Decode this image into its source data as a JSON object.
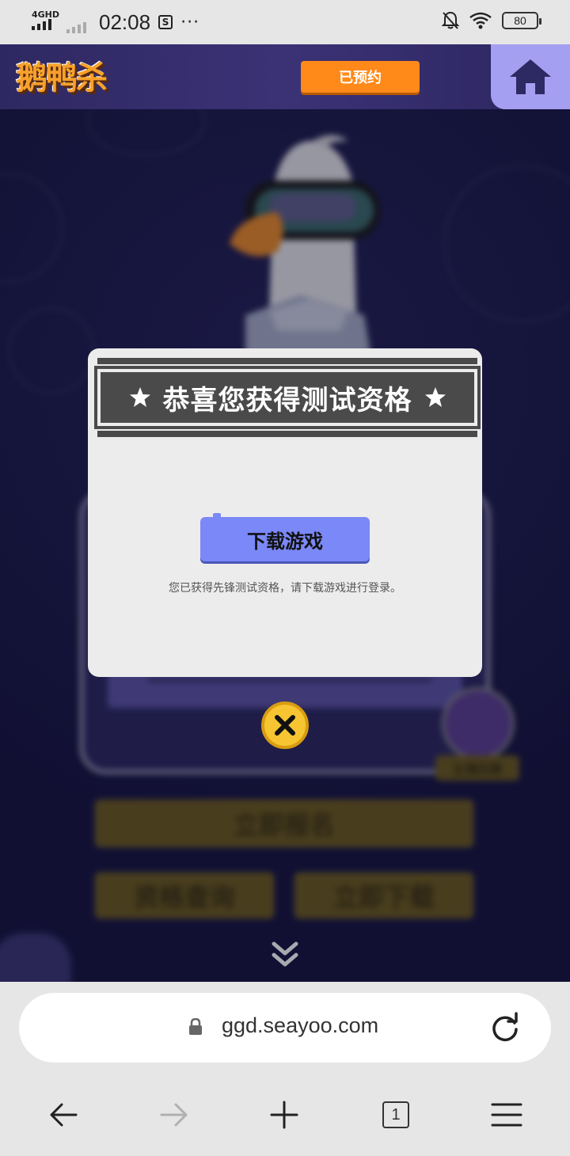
{
  "status_bar": {
    "network": "4GHD",
    "time": "02:08",
    "battery": "80"
  },
  "header": {
    "logo": "鹅鸭杀",
    "reserved_button": "已预约"
  },
  "modal": {
    "title": "恭喜您获得测试资格",
    "download_button": "下载游戏",
    "message": "您已获得先锋测试资格，请下载游戏进行登录。"
  },
  "background": {
    "signup_button": "立即报名",
    "query_button": "资格查询",
    "download_now_button": "立即下载",
    "streamer_badge": "主播招募"
  },
  "browser": {
    "url": "ggd.seayoo.com",
    "tab_count": "1"
  },
  "colors": {
    "accent_orange": "#ff8a1a",
    "download_blue": "#7b88f7",
    "close_yellow": "#f7c531"
  }
}
